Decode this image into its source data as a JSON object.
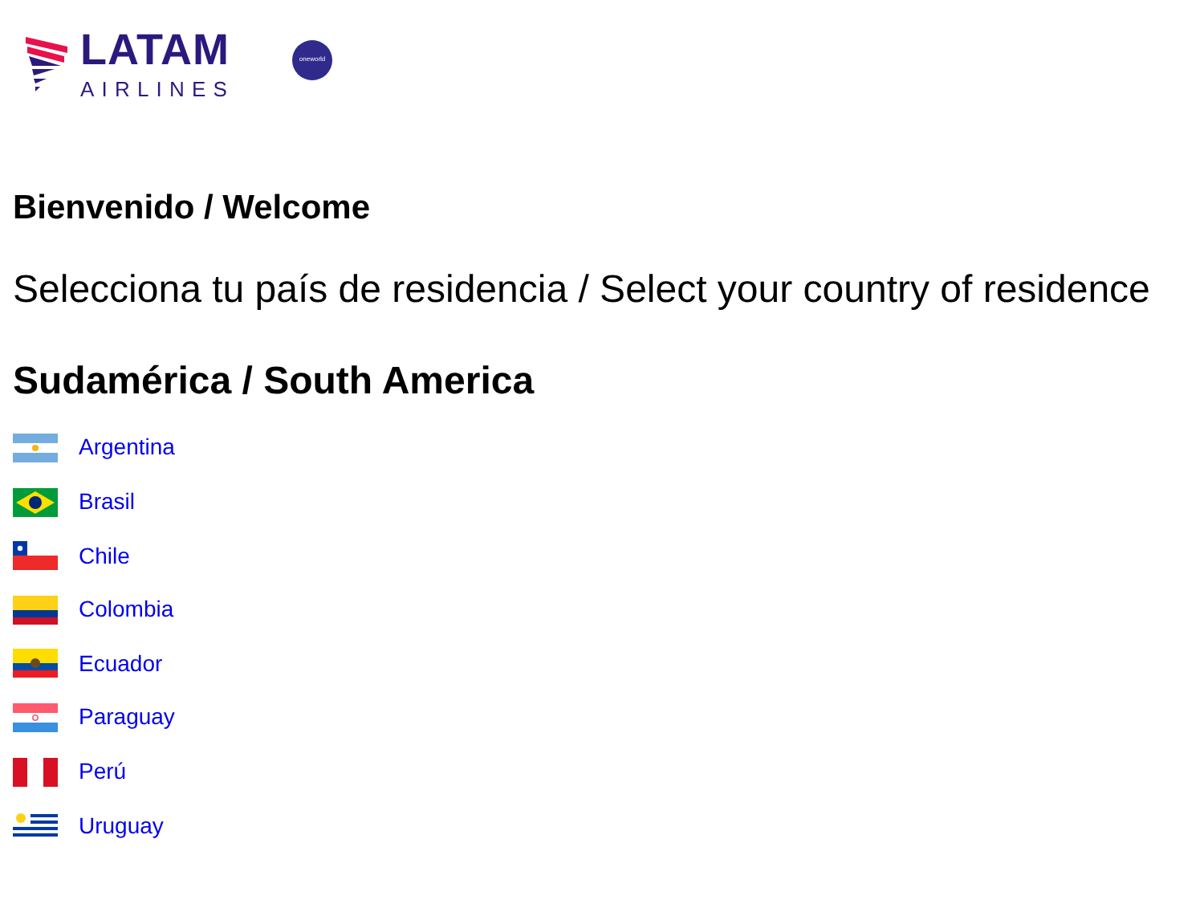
{
  "header": {
    "logo_name": "LATAM",
    "logo_subtitle": "AIRLINES",
    "alliance_badge": "oneworld"
  },
  "welcome": "Bienvenido / Welcome",
  "instruction": "Selecciona tu país de residencia / Select your country of residence",
  "region": "Sudamérica / South America",
  "countries": [
    {
      "name": "Argentina",
      "kind": "argentina"
    },
    {
      "name": "Brasil",
      "kind": "brazil"
    },
    {
      "name": "Chile",
      "kind": "chile"
    },
    {
      "name": "Colombia",
      "kind": "colombia"
    },
    {
      "name": "Ecuador",
      "kind": "ecuador"
    },
    {
      "name": "Paraguay",
      "kind": "paraguay"
    },
    {
      "name": "Perú",
      "kind": "peru"
    },
    {
      "name": "Uruguay",
      "kind": "uruguay"
    }
  ]
}
